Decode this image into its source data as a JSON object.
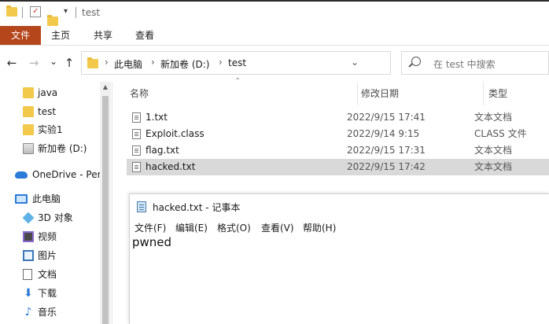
{
  "titlebar": {
    "title": "test",
    "dropdown_glyph": "▾"
  },
  "ribbon": {
    "tabs": [
      {
        "label": "文件",
        "active": true,
        "color": "#b5451b"
      },
      {
        "label": "主页"
      },
      {
        "label": "共享"
      },
      {
        "label": "查看"
      }
    ]
  },
  "nav": {
    "back_glyph": "←",
    "forward_glyph": "→",
    "recent_glyph": "⌄",
    "up_glyph": "↑",
    "refresh_glyph": "↻"
  },
  "address": {
    "crumbs": [
      "此电脑",
      "新加卷 (D:)",
      "test"
    ],
    "separator": "›",
    "dropdown_glyph": "⌄"
  },
  "search": {
    "placeholder": "在 test 中搜索"
  },
  "sidebar": {
    "items": [
      {
        "label": "java",
        "icon": "folder-icon"
      },
      {
        "label": "test",
        "icon": "folder-icon"
      },
      {
        "label": "实验1",
        "icon": "folder-icon"
      },
      {
        "label": "新加卷 (D:)",
        "icon": "drive-icon"
      },
      {
        "label": "OneDrive - Per",
        "icon": "cloud-icon"
      },
      {
        "label": "此电脑",
        "icon": "computer-icon"
      },
      {
        "label": "3D 对象",
        "icon": "3d-objects-icon"
      },
      {
        "label": "视频",
        "icon": "video-icon"
      },
      {
        "label": "图片",
        "icon": "pictures-icon"
      },
      {
        "label": "文档",
        "icon": "documents-icon"
      },
      {
        "label": "下载",
        "icon": "download-icon"
      },
      {
        "label": "音乐",
        "icon": "music-icon"
      }
    ]
  },
  "file_list": {
    "columns": [
      "名称",
      "修改日期",
      "类型"
    ],
    "sort_glyph": "⌃",
    "rows": [
      {
        "name": "1.txt",
        "date": "2022/9/15 17:41",
        "type": "文本文档",
        "selected": false
      },
      {
        "name": "Exploit.class",
        "date": "2022/9/14 9:15",
        "type": "CLASS 文件",
        "selected": false
      },
      {
        "name": "flag.txt",
        "date": "2022/9/15 17:31",
        "type": "文本文档",
        "selected": false
      },
      {
        "name": "hacked.txt",
        "date": "2022/9/15 17:42",
        "type": "文本文档",
        "selected": true
      }
    ]
  },
  "notepad": {
    "title": "hacked.txt - 记事本",
    "menu": [
      "文件(F)",
      "编辑(E)",
      "格式(O)",
      "查看(V)",
      "帮助(H)"
    ],
    "content": "pwned"
  },
  "colors": {
    "file_tab": "#b5451b",
    "folder": "#f3c94b",
    "selection": "#d9d9d9",
    "accent_blue": "#2b7bd8"
  }
}
